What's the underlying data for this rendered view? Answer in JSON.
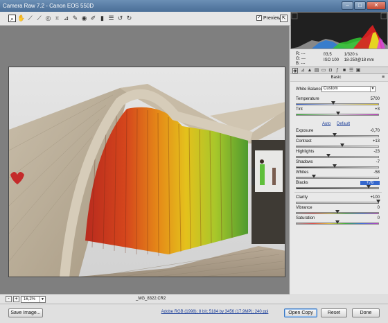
{
  "window": {
    "title": "Camera Raw 7.2  -  Canon EOS 550D"
  },
  "toolbar": {
    "tools": [
      "zoom-icon",
      "hand-icon",
      "white-balance-icon",
      "color-sampler-icon",
      "target-adjust-icon",
      "crop-icon",
      "straighten-icon",
      "spot-removal-icon",
      "red-eye-icon",
      "adjustment-brush-icon",
      "graduated-filter-icon",
      "preferences-icon",
      "rotate-left-icon",
      "rotate-right-icon"
    ],
    "preview_label": "Preview",
    "preview_checked": true
  },
  "readouts": {
    "r_label": "R:",
    "g_label": "G:",
    "b_label": "B:",
    "r_value": "---",
    "g_value": "---",
    "b_value": "---",
    "aperture": "f/3,5",
    "shutter": "1/320 s",
    "iso": "ISO 100",
    "lens": "18-250@18 mm"
  },
  "panel": {
    "title": "Basic",
    "tabs": [
      "basic-tab-icon",
      "tone-curve-tab-icon",
      "detail-tab-icon",
      "hsl-tab-icon",
      "split-toning-tab-icon",
      "lens-corrections-tab-icon",
      "effects-tab-icon",
      "camera-calibration-tab-icon",
      "presets-tab-icon",
      "snapshots-tab-icon"
    ],
    "white_balance_label": "White Balance:",
    "white_balance_value": "Custom",
    "auto_label": "Auto",
    "default_label": "Default",
    "sliders": [
      {
        "label": "Temperature",
        "value": "5700",
        "level": 0.45
      },
      {
        "label": "Tint",
        "value": "+3",
        "level": 0.51
      },
      {
        "label": "Exposure",
        "value": "-0,70",
        "level": 0.47
      },
      {
        "label": "Contrast",
        "value": "+13",
        "level": 0.56
      },
      {
        "label": "Highlights",
        "value": "-23",
        "level": 0.39
      },
      {
        "label": "Shadows",
        "value": "-7",
        "level": 0.47
      },
      {
        "label": "Whites",
        "value": "-58",
        "level": 0.21
      },
      {
        "label": "Blacks",
        "value": "+76",
        "level": 0.88
      },
      {
        "label": "Clarity",
        "value": "+100",
        "level": 1.0
      },
      {
        "label": "Vibrance",
        "value": "0",
        "level": 0.5
      },
      {
        "label": "Saturation",
        "value": "0",
        "level": 0.5
      }
    ]
  },
  "zoom": {
    "minus": "-",
    "plus": "+",
    "level": "16,2%"
  },
  "filename": "_MG_8322.CR2",
  "footer": {
    "save_label": "Save Image...",
    "workflow_label": "Adobe RGB (1998); 8 bit; 5184 by 3456 (17,9MP); 240 ppi",
    "open_label": "Open Copy",
    "reset_label": "Reset",
    "done_label": "Done"
  }
}
